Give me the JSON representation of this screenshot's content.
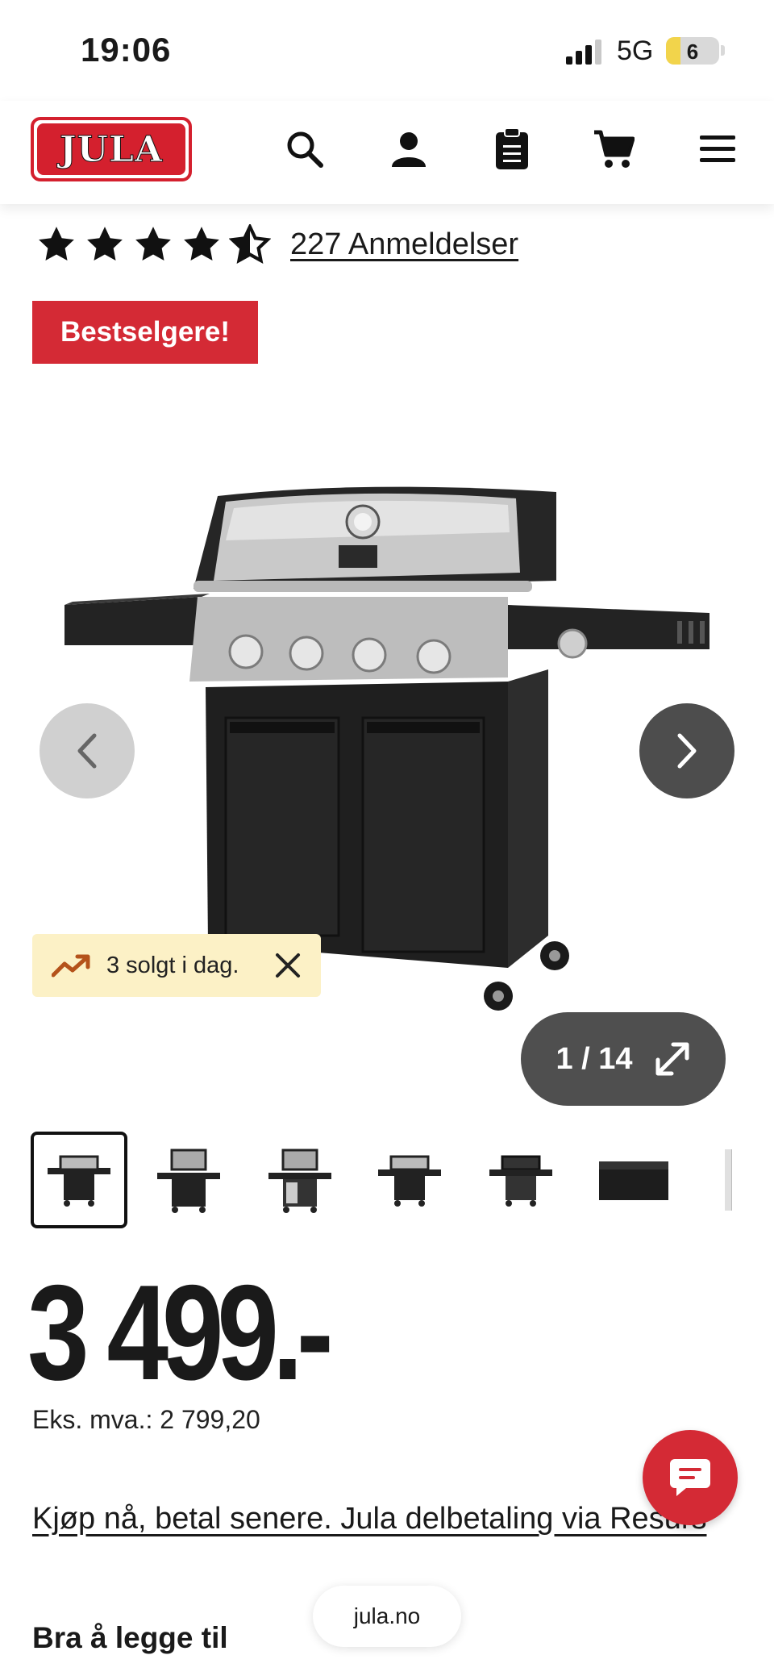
{
  "status_bar": {
    "time": "19:06",
    "network": "5G",
    "battery": "6",
    "battery_level": 0.06
  },
  "header": {
    "logo_text": "JULA",
    "icons": [
      "search-icon",
      "account-icon",
      "clipboard-icon",
      "cart-icon",
      "menu-icon"
    ]
  },
  "rating": {
    "stars": 4.5,
    "reviews_label": "227 Anmeldelser"
  },
  "badge": "Bestselgere!",
  "gallery": {
    "sold_today": "3 solgt i dag.",
    "counter": "1 / 14",
    "thumbnail_count": 7,
    "active_index": 0
  },
  "product": {
    "price": "3 499.-",
    "ex_vat": "Eks. mva.: 2 799,20",
    "pay_later": "Kjøp nå, betal senere. Jula delbetaling via Resurs"
  },
  "section_title": "Bra å legge til",
  "browser": {
    "domain": "jula.no"
  },
  "colors": {
    "brand_red": "#d42a35",
    "sold_bg": "#fcf1c6",
    "dark": "#4f4f4f"
  }
}
